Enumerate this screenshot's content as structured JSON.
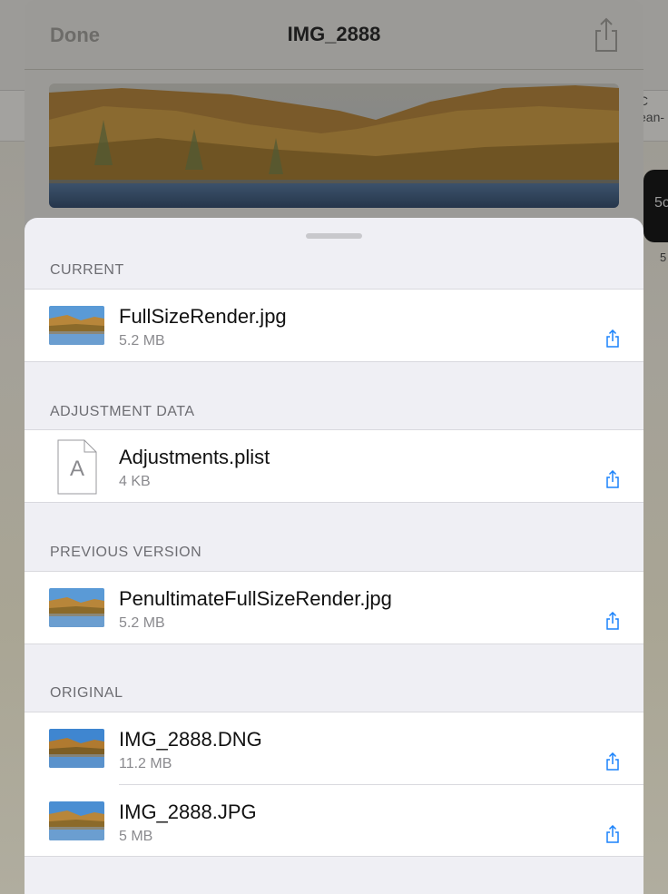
{
  "background": {
    "right_text_lines": [
      "C",
      "ean-"
    ],
    "right_tile_text": "5c",
    "right_sub_text": "5"
  },
  "viewer": {
    "done_label": "Done",
    "title": "IMG_2888",
    "share_icon": "share-icon"
  },
  "sheet": {
    "sections": [
      {
        "header": "CURRENT",
        "files": [
          {
            "name": "FullSizeRender.jpg",
            "size": "5.2 MB",
            "icon": "photo-thumbnail"
          }
        ]
      },
      {
        "header": "ADJUSTMENT DATA",
        "files": [
          {
            "name": "Adjustments.plist",
            "size": "4 KB",
            "icon": "document-icon",
            "doc_letter": "A"
          }
        ]
      },
      {
        "header": "PREVIOUS VERSION",
        "files": [
          {
            "name": "PenultimateFullSizeRender.jpg",
            "size": "5.2 MB",
            "icon": "photo-thumbnail"
          }
        ]
      },
      {
        "header": "ORIGINAL",
        "files": [
          {
            "name": "IMG_2888.DNG",
            "size": "11.2 MB",
            "icon": "photo-thumbnail"
          },
          {
            "name": "IMG_2888.JPG",
            "size": "5 MB",
            "icon": "photo-thumbnail"
          }
        ]
      }
    ]
  },
  "colors": {
    "accent": "#1a82fb",
    "sheet_bg": "#efeff4",
    "section_text": "#6d6d72"
  }
}
